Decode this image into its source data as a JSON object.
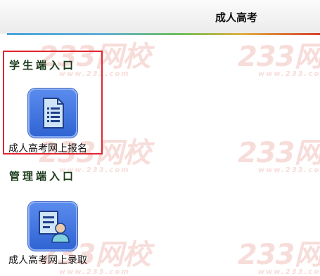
{
  "header": {
    "title": "成人高考"
  },
  "watermark": {
    "logo_text": "233网校",
    "domain_text": "www.233.com"
  },
  "student_section": {
    "heading": "学生端入口",
    "entry": {
      "icon": "document-list-icon",
      "label": "成人高考网上报名"
    }
  },
  "admin_section": {
    "heading": "管理端入口",
    "entry": {
      "icon": "admin-user-icon",
      "label": "成人高考网上录取"
    }
  },
  "colors": {
    "highlight": "#e2262f",
    "icon_blue": "#3f73e0",
    "watermark": "#f3c7c2"
  }
}
